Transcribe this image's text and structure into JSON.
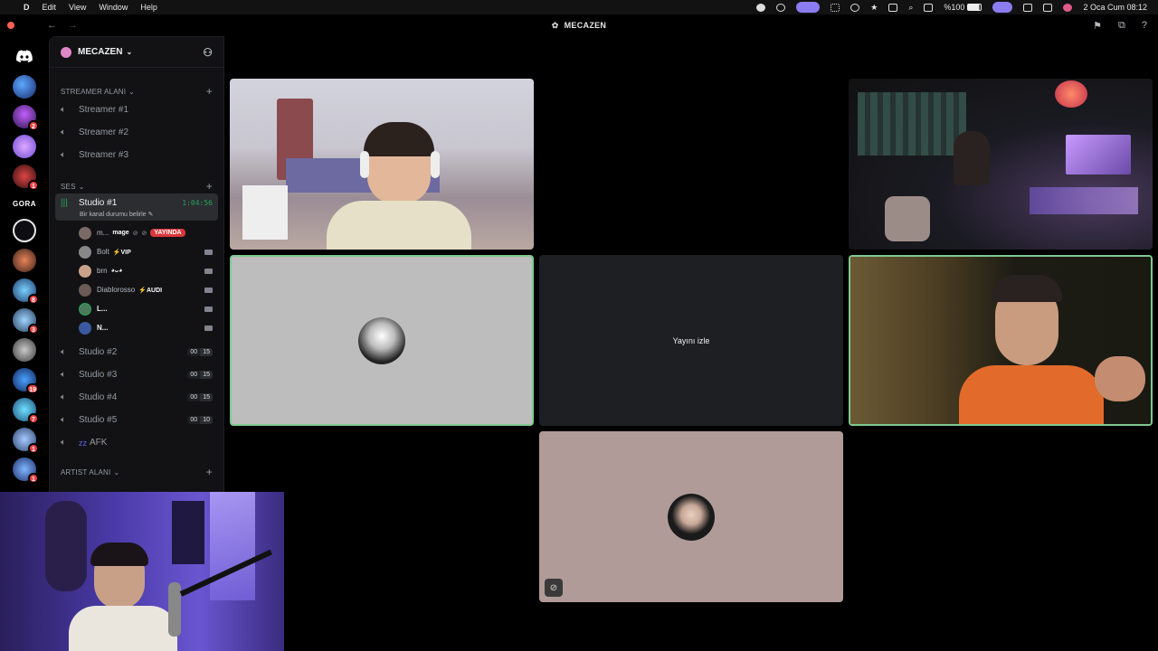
{
  "menubar": {
    "app_name": "D",
    "items": [
      "Edit",
      "View",
      "Window",
      "Help"
    ],
    "battery": "%100",
    "datetime": "2 Oca Cum  08:12"
  },
  "window": {
    "title": "MECAZEN",
    "back_arrow": "←",
    "forward_arrow": "→"
  },
  "rail": {
    "badges": [
      "",
      "2",
      "",
      "1",
      "",
      "",
      "",
      "8",
      "3",
      "",
      "19",
      "7",
      "1",
      "1"
    ],
    "text_server": "GORA"
  },
  "sidebar": {
    "server_name": "MECAZEN",
    "categories": {
      "streamer": "STREAMER ALANI",
      "ses": "SES",
      "artist": "ARTIST ALANI"
    },
    "streamer_channels": [
      "Streamer #1",
      "Streamer #2",
      "Streamer #3"
    ],
    "active_channel": {
      "name": "Studio #1",
      "timer": "1:04:56",
      "status": "Bir kanal durumu belirle"
    },
    "members": [
      {
        "name": "m...",
        "tag": "mage",
        "live": "YAYINDA"
      },
      {
        "name": "Bolt",
        "tag": "⚡VIP"
      },
      {
        "name": "brn",
        "tag": "◕ᴗ◕"
      },
      {
        "name": "Diablorosso",
        "tag": "⚡AUDI"
      },
      {
        "name": "L..."
      },
      {
        "name": "N..."
      }
    ],
    "voice_channels": [
      {
        "name": "Studio #2",
        "count": "00",
        "limit": "15"
      },
      {
        "name": "Studio #3",
        "count": "00",
        "limit": "15"
      },
      {
        "name": "Studio #4",
        "count": "00",
        "limit": "15"
      },
      {
        "name": "Studio #5",
        "count": "00",
        "limit": "10"
      }
    ],
    "afk_channel": "AFK"
  },
  "stage": {
    "watch_stream_label": "Yayını izle",
    "more_label": "···"
  },
  "colors": {
    "accent_green": "#23a559",
    "live_red": "#da373c",
    "badge_red": "#f23f43",
    "sidebar_bg": "#121214"
  }
}
